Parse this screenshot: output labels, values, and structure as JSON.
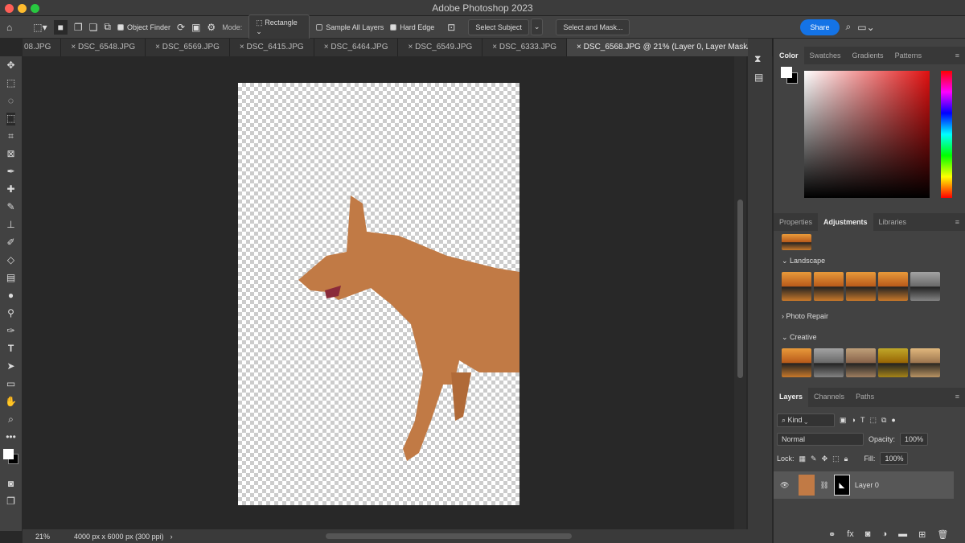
{
  "window": {
    "title": "Adobe Photoshop 2023"
  },
  "options": {
    "object_finder": "Object Finder",
    "mode_label": "Mode:",
    "mode_value": "Rectangle",
    "sample_all_layers": "Sample All Layers",
    "hard_edge": "Hard Edge",
    "select_subject": "Select Subject",
    "select_and_mask": "Select and Mask...",
    "share": "Share"
  },
  "tabs": [
    {
      "label": "08.JPG"
    },
    {
      "label": "DSC_6548.JPG"
    },
    {
      "label": "DSC_6569.JPG"
    },
    {
      "label": "DSC_6415.JPG"
    },
    {
      "label": "DSC_6464.JPG"
    },
    {
      "label": "DSC_6549.JPG"
    },
    {
      "label": "DSC_6333.JPG"
    },
    {
      "label": "DSC_6568.JPG @ 21% (Layer 0, Layer Mask/8) *"
    }
  ],
  "status": {
    "zoom": "21%",
    "doc_info": "4000 px x 6000 px (300 ppi)"
  },
  "color_panel": {
    "tabs": [
      "Color",
      "Swatches",
      "Gradients",
      "Patterns"
    ],
    "accent": "#1473e6"
  },
  "adjust_panel": {
    "tabs": [
      "Properties",
      "Adjustments",
      "Libraries"
    ],
    "sections": [
      "Landscape",
      "Photo Repair",
      "Creative"
    ]
  },
  "layers_panel": {
    "tabs": [
      "Layers",
      "Channels",
      "Paths"
    ],
    "filter": "Kind",
    "blend_mode": "Normal",
    "opacity_label": "Opacity:",
    "opacity": "100%",
    "lock_label": "Lock:",
    "fill_label": "Fill:",
    "fill": "100%",
    "layers": [
      {
        "name": "Layer 0"
      }
    ]
  }
}
